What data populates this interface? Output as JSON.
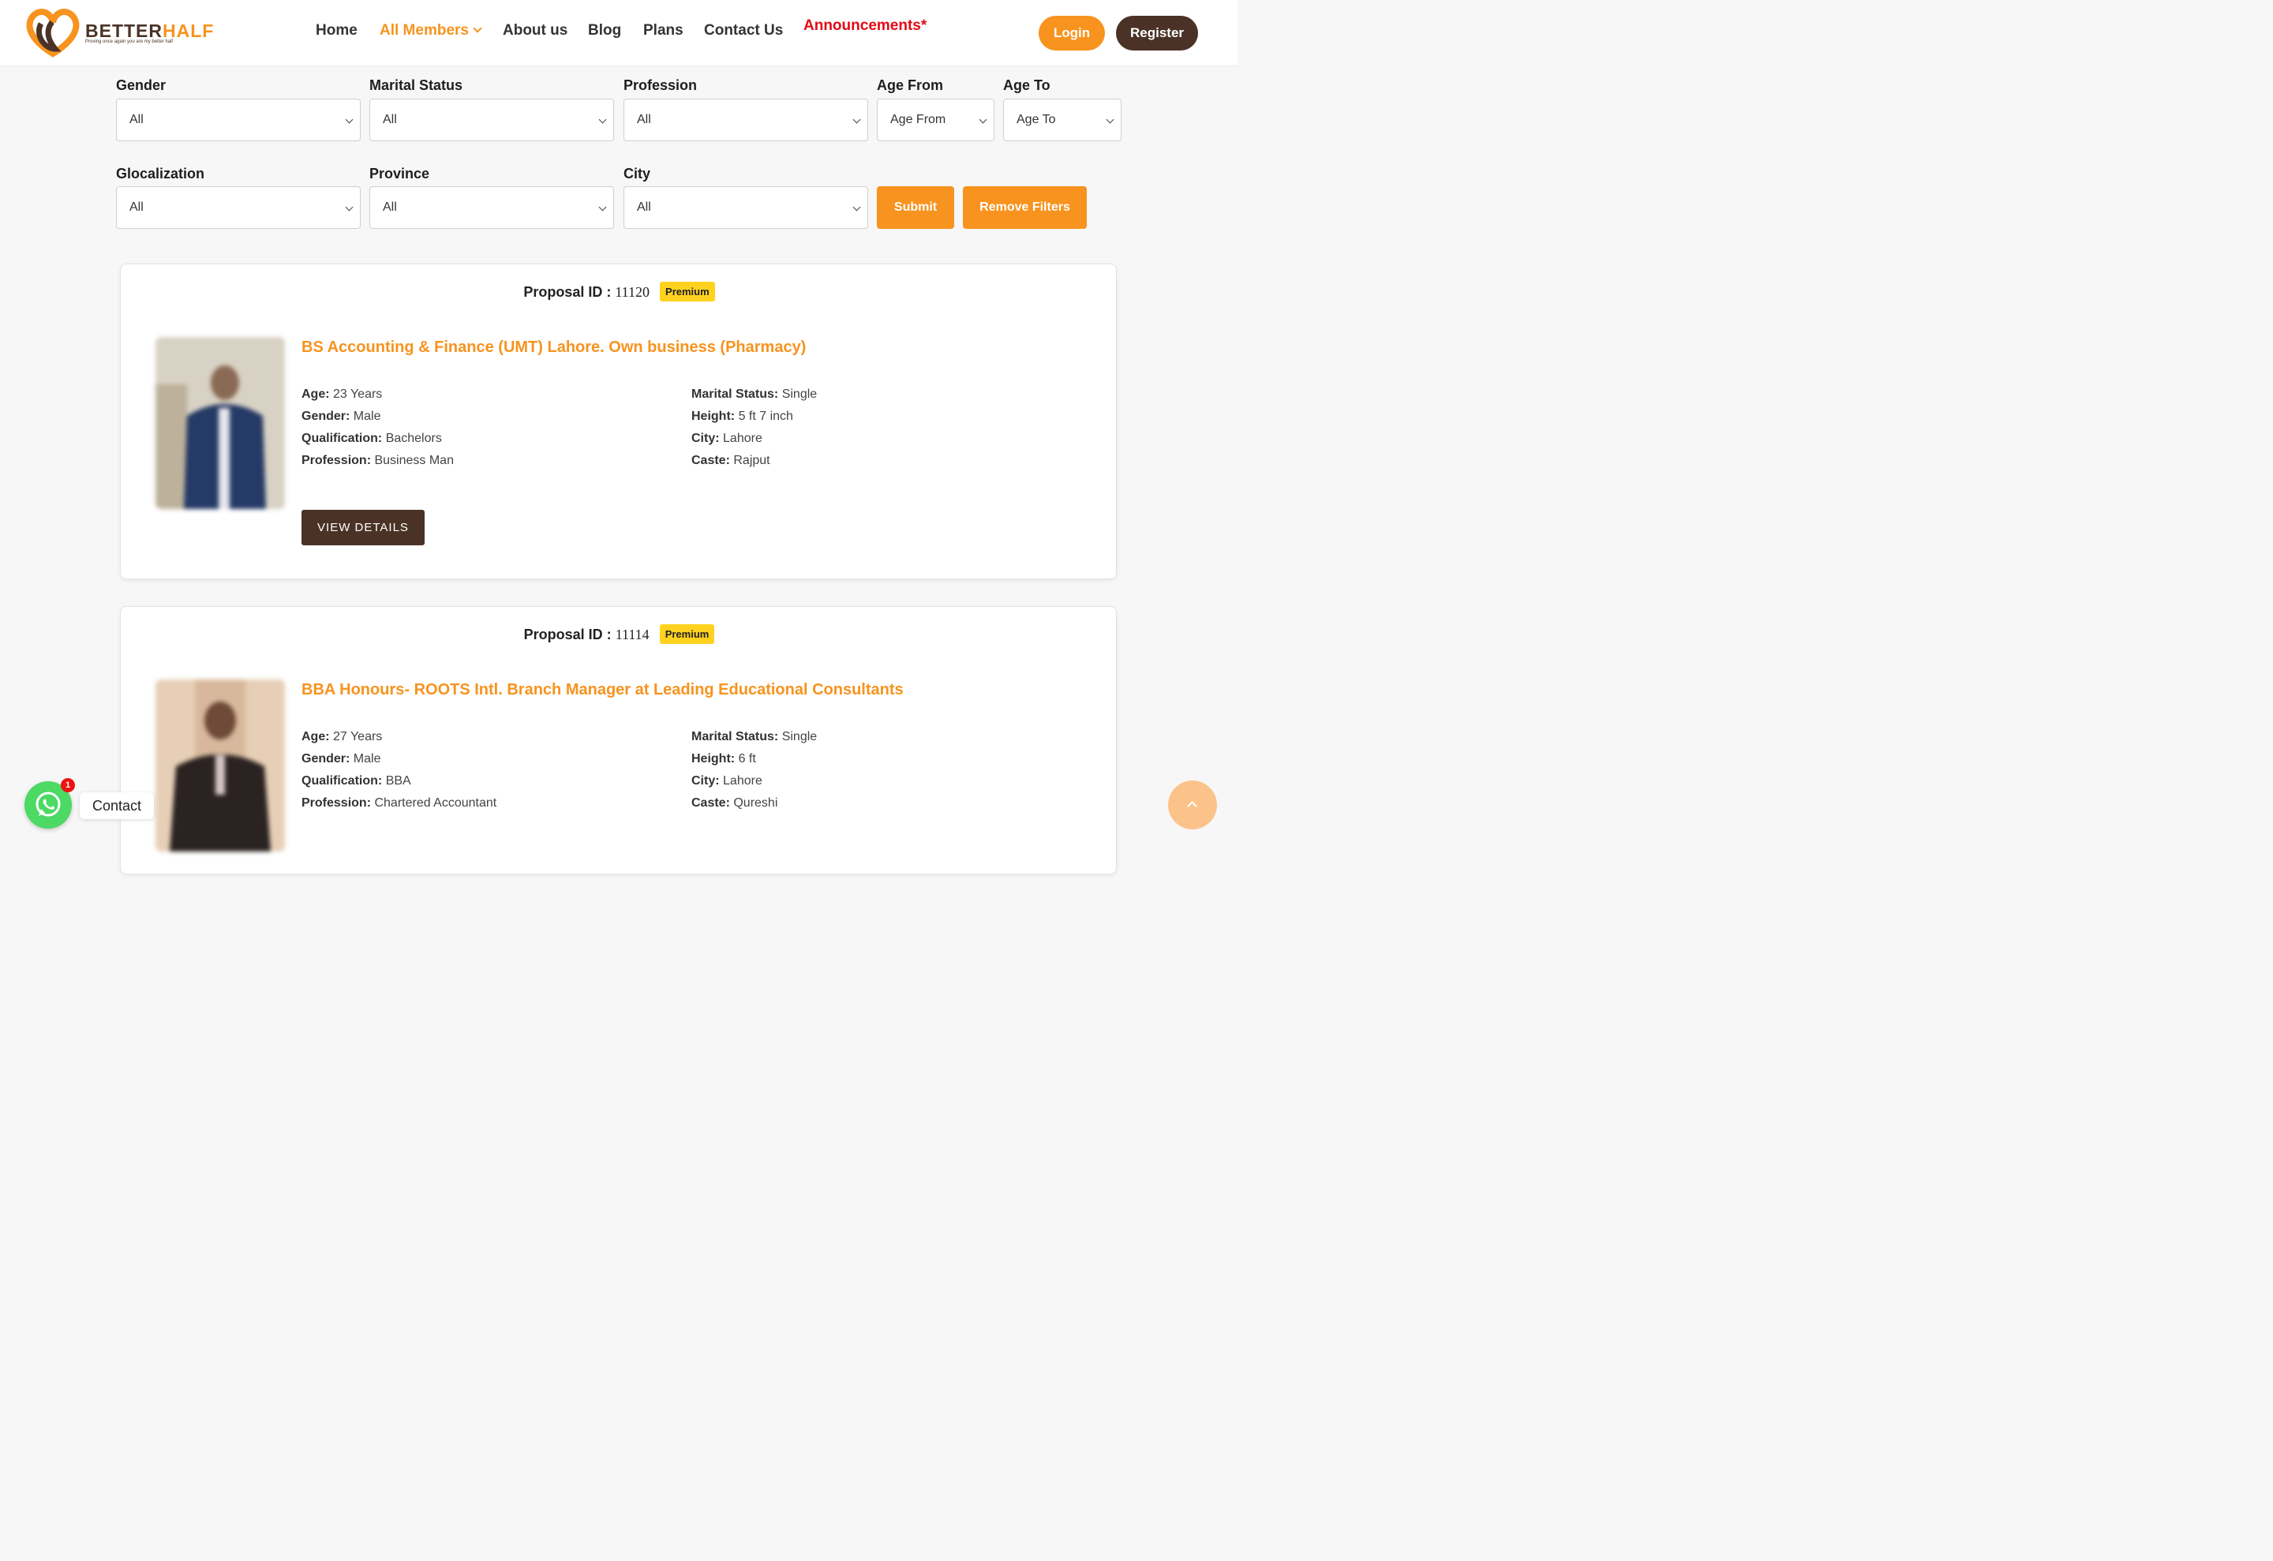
{
  "brand": {
    "name_part1": "BETTER",
    "name_part2": "HALF",
    "tagline": "Proving once again  you are my better half",
    "colors": {
      "orange": "#f7931e",
      "brown": "#4a3326",
      "announce_red": "#e50914",
      "premium_yellow": "#ffd21f"
    }
  },
  "nav": {
    "home": "Home",
    "all_members": "All Members",
    "about": "About us",
    "blog": "Blog",
    "plans": "Plans",
    "contact": "Contact Us",
    "announcements": "Announcements*",
    "login": "Login",
    "register": "Register"
  },
  "filters": {
    "gender": {
      "label": "Gender",
      "value": "All"
    },
    "marital_status": {
      "label": "Marital Status",
      "value": "All"
    },
    "profession": {
      "label": "Profession",
      "value": "All"
    },
    "age_from": {
      "label": "Age From",
      "value": "Age From"
    },
    "age_to": {
      "label": "Age To",
      "value": "Age To"
    },
    "glocalization": {
      "label": "Glocalization",
      "value": "All"
    },
    "province": {
      "label": "Province",
      "value": "All"
    },
    "city": {
      "label": "City",
      "value": "All"
    },
    "submit": "Submit",
    "remove": "Remove Filters"
  },
  "proposals": [
    {
      "id_label": "Proposal ID :",
      "id": "11120",
      "badge": "Premium",
      "title": "BS Accounting & Finance (UMT) Lahore. Own business (Pharmacy)",
      "age_label": "Age:",
      "age": "23 Years",
      "gender_label": "Gender:",
      "gender": "Male",
      "qualification_label": "Qualification:",
      "qualification": "Bachelors",
      "profession_label": "Profession:",
      "profession": "Business Man",
      "marital_label": "Marital Status:",
      "marital": "Single",
      "height_label": "Height:",
      "height": "5 ft 7 inch",
      "city_label": "City:",
      "city": "Lahore",
      "caste_label": "Caste:",
      "caste": "Rajput",
      "button": "VIEW DETAILS"
    },
    {
      "id_label": "Proposal ID :",
      "id": "11114",
      "badge": "Premium",
      "title": "BBA Honours- ROOTS Intl. Branch Manager at Leading Educational Consultants",
      "age_label": "Age:",
      "age": "27 Years",
      "gender_label": "Gender:",
      "gender": "Male",
      "qualification_label": "Qualification:",
      "qualification": "BBA",
      "profession_label": "Profession:",
      "profession": "Chartered Accountant",
      "marital_label": "Marital Status:",
      "marital": "Single",
      "height_label": "Height:",
      "height": "6 ft",
      "city_label": "City:",
      "city": "Lahore",
      "caste_label": "Caste:",
      "caste": "Qureshi"
    }
  ],
  "whatsapp": {
    "badge": "1",
    "label": "Contact",
    "icon": "whatsapp-icon"
  },
  "scroll_top": {
    "icon": "chevron-up-icon"
  }
}
